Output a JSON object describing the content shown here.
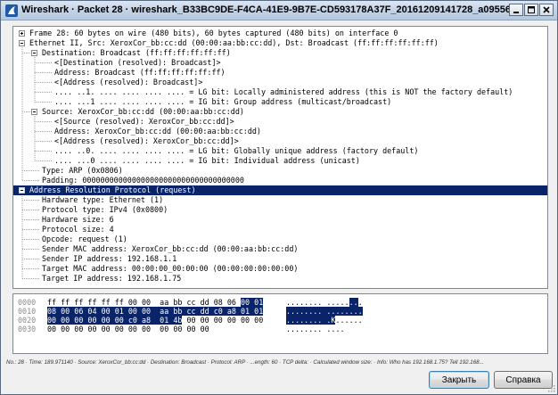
{
  "window": {
    "title": "Wireshark · Packet 28 · wireshark_B33BC9DE-F4CA-41E9-9B7E-CD593178A37F_20161209141728_a09556"
  },
  "tree": [
    {
      "depth": 0,
      "expander": "plus",
      "text": "Frame 28: 60 bytes on wire (480 bits), 60 bytes captured (480 bits) on interface 0"
    },
    {
      "depth": 0,
      "expander": "minus",
      "text": "Ethernet II, Src: XeroxCor_bb:cc:dd (00:00:aa:bb:cc:dd), Dst: Broadcast (ff:ff:ff:ff:ff:ff)"
    },
    {
      "depth": 1,
      "expander": "minus",
      "text": "Destination: Broadcast (ff:ff:ff:ff:ff:ff)"
    },
    {
      "depth": 2,
      "expander": "",
      "text": "<[Destination (resolved): Broadcast]>"
    },
    {
      "depth": 2,
      "expander": "",
      "text": "Address: Broadcast (ff:ff:ff:ff:ff:ff)"
    },
    {
      "depth": 2,
      "expander": "",
      "text": "<[Address (resolved): Broadcast]>"
    },
    {
      "depth": 2,
      "expander": "",
      "text": ".... ..1. .... .... .... .... = LG bit: Locally administered address (this is NOT the factory default)"
    },
    {
      "depth": 2,
      "expander": "",
      "text": ".... ...1 .... .... .... .... = IG bit: Group address (multicast/broadcast)"
    },
    {
      "depth": 1,
      "expander": "minus",
      "text": "Source: XeroxCor_bb:cc:dd (00:00:aa:bb:cc:dd)"
    },
    {
      "depth": 2,
      "expander": "",
      "text": "<[Source (resolved): XeroxCor_bb:cc:dd]>"
    },
    {
      "depth": 2,
      "expander": "",
      "text": "Address: XeroxCor_bb:cc:dd (00:00:aa:bb:cc:dd)"
    },
    {
      "depth": 2,
      "expander": "",
      "text": "<[Address (resolved): XeroxCor_bb:cc:dd]>"
    },
    {
      "depth": 2,
      "expander": "",
      "text": ".... ..0. .... .... .... .... = LG bit: Globally unique address (factory default)"
    },
    {
      "depth": 2,
      "expander": "",
      "text": ".... ...0 .... .... .... .... = IG bit: Individual address (unicast)"
    },
    {
      "depth": 1,
      "expander": "",
      "text": "Type: ARP (0x0806)"
    },
    {
      "depth": 1,
      "expander": "",
      "text": "Padding: 000000000000000000000000000000000000"
    },
    {
      "depth": 0,
      "expander": "minus",
      "text": "Address Resolution Protocol (request)",
      "selected": true
    },
    {
      "depth": 1,
      "expander": "",
      "text": "Hardware type: Ethernet (1)"
    },
    {
      "depth": 1,
      "expander": "",
      "text": "Protocol type: IPv4 (0x0800)"
    },
    {
      "depth": 1,
      "expander": "",
      "text": "Hardware size: 6"
    },
    {
      "depth": 1,
      "expander": "",
      "text": "Protocol size: 4"
    },
    {
      "depth": 1,
      "expander": "",
      "text": "Opcode: request (1)"
    },
    {
      "depth": 1,
      "expander": "",
      "text": "Sender MAC address: XeroxCor_bb:cc:dd (00:00:aa:bb:cc:dd)"
    },
    {
      "depth": 1,
      "expander": "",
      "text": "Sender IP address: 192.168.1.1"
    },
    {
      "depth": 1,
      "expander": "",
      "text": "Target MAC address: 00:00:00_00:00:00 (00:00:00:00:00:00)"
    },
    {
      "depth": 1,
      "expander": "",
      "text": "Target IP address: 192.168.1.75"
    }
  ],
  "hex": [
    {
      "offset": "0000",
      "bytes": [
        "ff",
        "ff",
        "ff",
        "ff",
        "ff",
        "ff",
        "00",
        "00",
        "aa",
        "bb",
        "cc",
        "dd",
        "08",
        "06",
        "00",
        "01"
      ],
      "hl_from": 14,
      "hl_to": 15,
      "ascii": "................",
      "ascii_hl_from": 14,
      "ascii_hl_to": 15,
      "ascii_ext": "........ ........"
    },
    {
      "offset": "0010",
      "bytes": [
        "08",
        "00",
        "06",
        "04",
        "00",
        "01",
        "00",
        "00",
        "aa",
        "bb",
        "cc",
        "dd",
        "c0",
        "a8",
        "01",
        "01"
      ],
      "hl_from": 0,
      "hl_to": 15,
      "ascii_ext": "........ ........"
    },
    {
      "offset": "0020",
      "bytes": [
        "00",
        "00",
        "00",
        "00",
        "00",
        "00",
        "c0",
        "a8",
        "01",
        "4b",
        "00",
        "00",
        "00",
        "00",
        "00",
        "00"
      ],
      "hl_from": 0,
      "hl_to": 9,
      "ascii_ext": "........ .K......"
    },
    {
      "offset": "0030",
      "bytes": [
        "00",
        "00",
        "00",
        "00",
        "00",
        "00",
        "00",
        "00",
        "00",
        "00",
        "00",
        "00"
      ],
      "hl_from": -1,
      "hl_to": -1,
      "ascii_ext": "........ ...."
    }
  ],
  "hex_ascii_hl": [
    [
      14,
      16
    ],
    [
      0,
      17
    ],
    [
      0,
      11
    ],
    [
      -1,
      -1
    ]
  ],
  "status": "No.: 28 · Time: 189.971140 · Source: XeroxCor_bb:cc:dd · Destination: Broadcast · Protocol: ARP · ...ength: 60 · TCP delta: · Calculated window size: · Info: Who has 192.168.1.75? Tell 192.168...",
  "buttons": {
    "close": "Закрыть",
    "help": "Справка"
  },
  "colors": {
    "selection": "#0a246a",
    "offset_text": "#8a8a8a"
  }
}
